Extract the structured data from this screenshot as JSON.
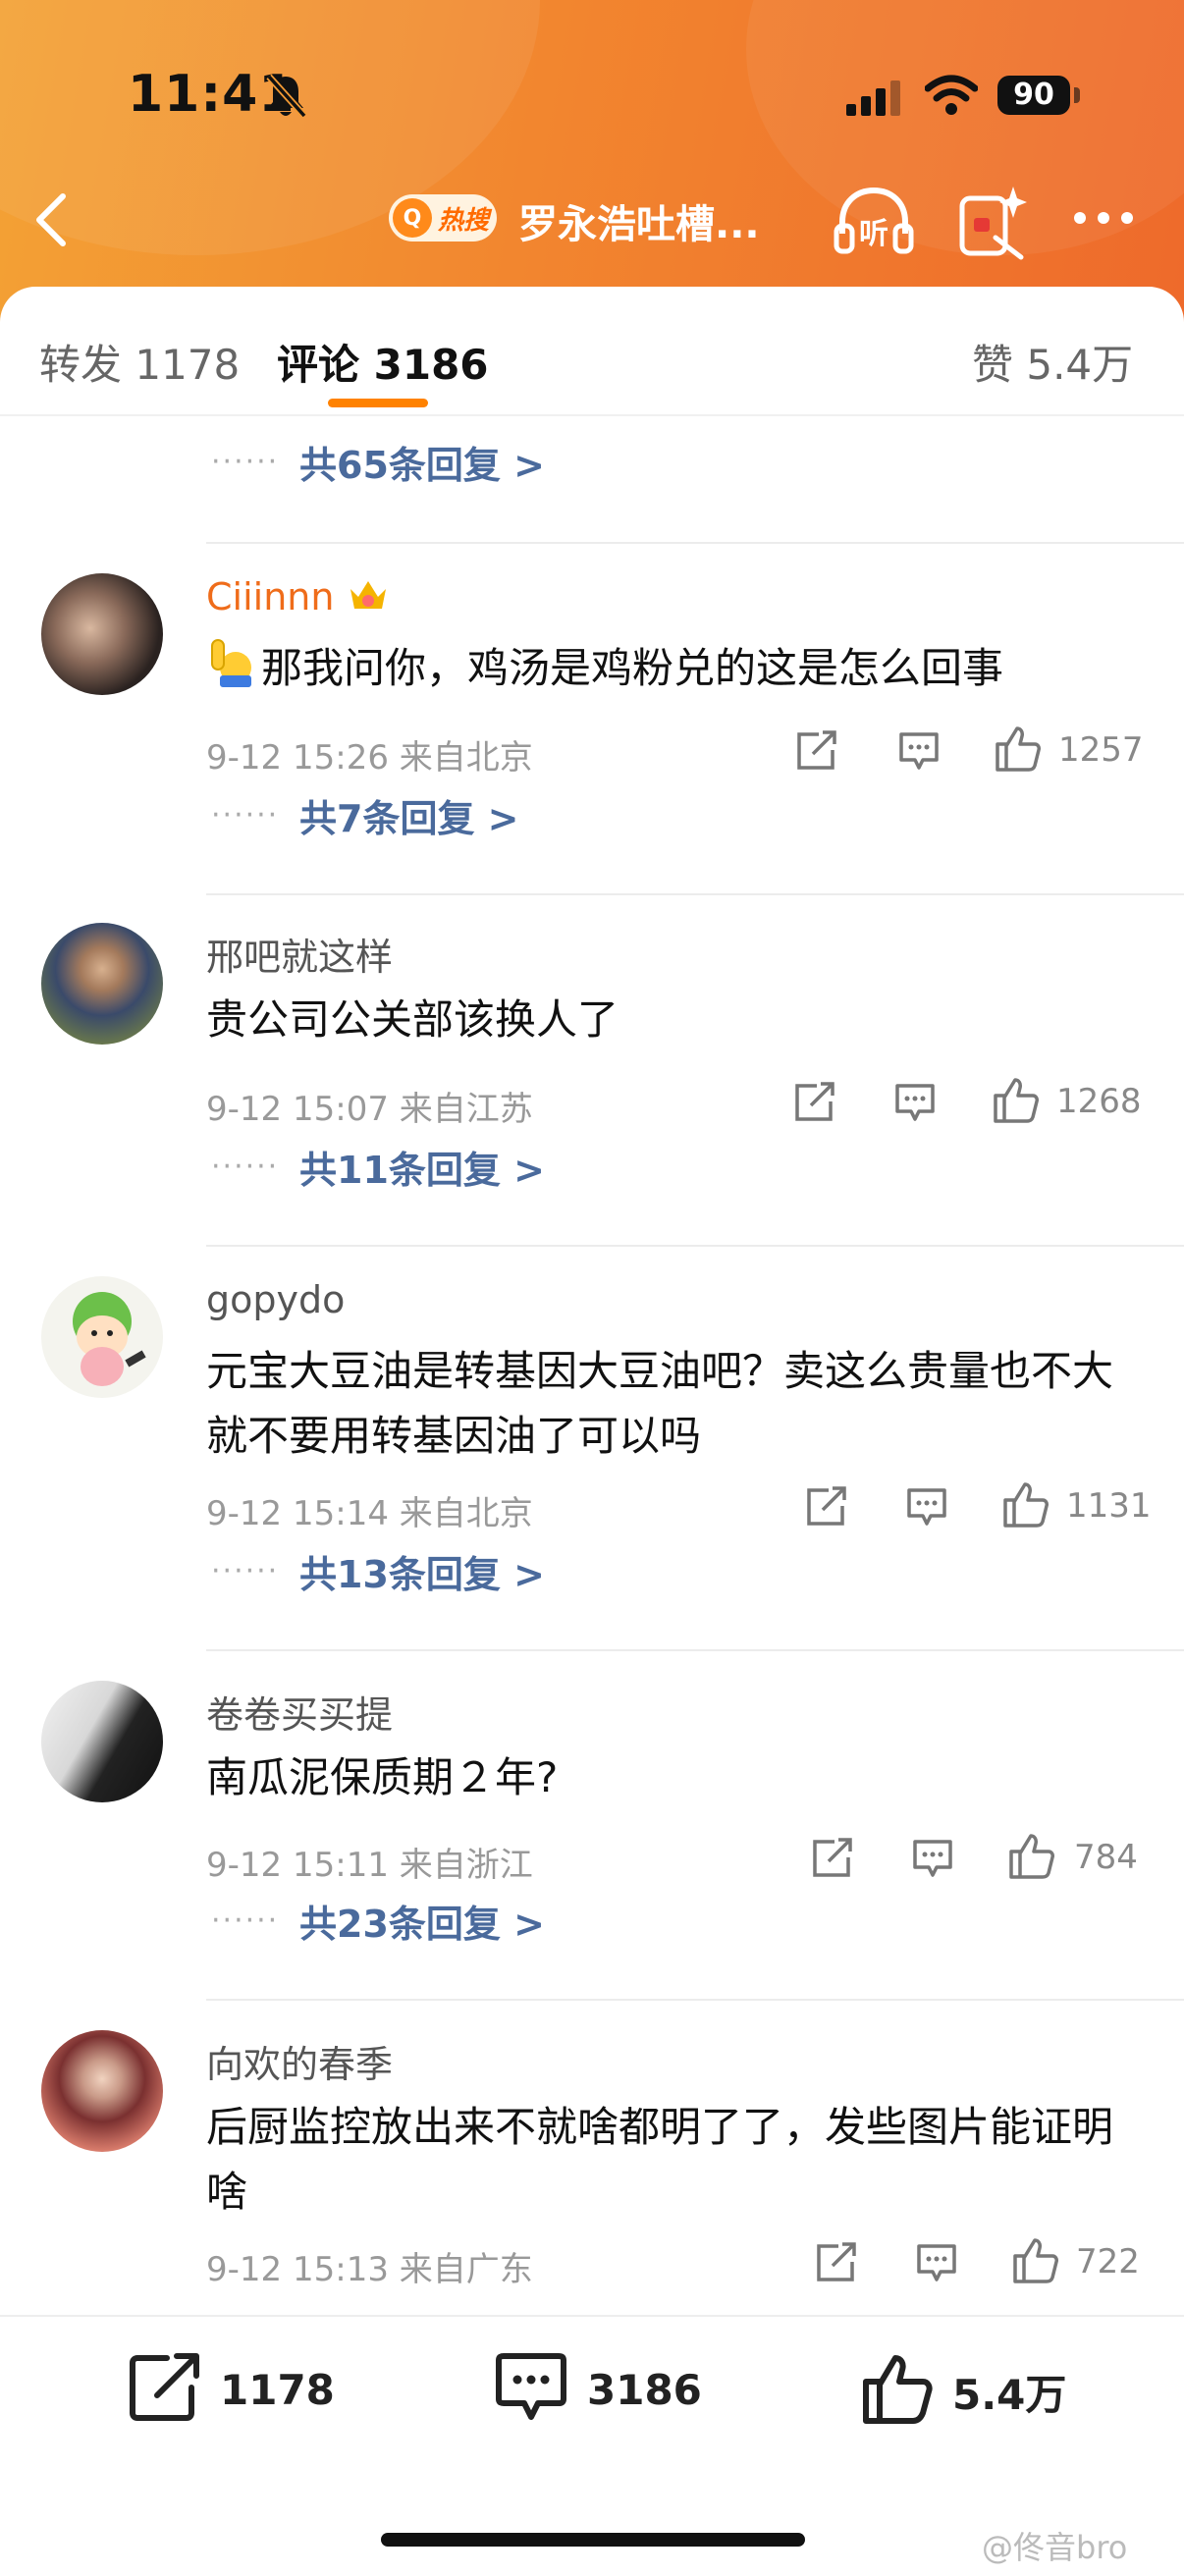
{
  "status_bar": {
    "time": "11:41",
    "battery": "90"
  },
  "nav": {
    "hot_badge": "热搜",
    "title": "罗永浩吐槽..."
  },
  "tabs": {
    "repost": "转发 1178",
    "comment": "评论 3186",
    "likes": "赞 5.4万"
  },
  "first_replies": "共65条回复 >",
  "comments": [
    {
      "user": "Ciiinnn",
      "text": "那我问你，鸡汤是鸡粉兑的这是怎么回事",
      "meta": "9-12 15:26 来自北京",
      "likes": "1257",
      "replies": "共7条回复 >"
    },
    {
      "user": "邢吧就这样",
      "text": "贵公司公关部该换人了",
      "meta": "9-12 15:07 来自江苏",
      "likes": "1268",
      "replies": "共11条回复 >"
    },
    {
      "user": "gopydo",
      "text": "元宝大豆油是转基因大豆油吧？卖这么贵量也不大 就不要用转基因油了可以吗",
      "meta": "9-12 15:14 来自北京",
      "likes": "1131",
      "replies": "共13条回复 >"
    },
    {
      "user": "卷卷买买提",
      "text": "南瓜泥保质期２年?",
      "meta": "9-12 15:11 来自浙江",
      "likes": "784",
      "replies": "共23条回复 >"
    },
    {
      "user": "向欢的春季",
      "text": "后厨监控放出来不就啥都明了了，发些图片能证明啥",
      "meta": "9-12 15:13 来自广东",
      "likes": "722"
    }
  ],
  "bottom_bar": {
    "repost": "1178",
    "comment": "3186",
    "like": "5.4万"
  },
  "watermark": "@佟音bro",
  "colors": {
    "header_orange": "#f2862f",
    "accent": "#ff8200",
    "link": "#4a6a9c",
    "vip_name": "#ef6c1a"
  }
}
